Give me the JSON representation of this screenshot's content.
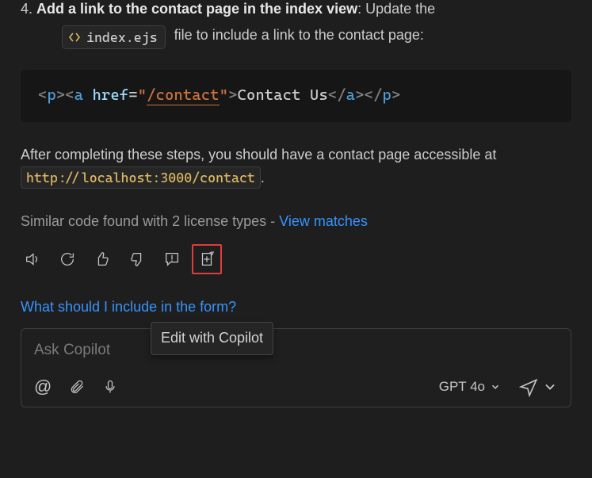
{
  "step": {
    "number": "4.",
    "bold": "Add a link to the contact page in the index view",
    "colon": ": Update the",
    "file_icon": "code-icon",
    "file_name": "index.ejs",
    "tail": "file to include a link to the contact page:"
  },
  "code": {
    "open_p_l": "<",
    "open_p_n": "p",
    "open_p_r": "><",
    "open_a_n": "a",
    "attr_name": " href",
    "attr_eq": "=",
    "attr_q1": "\"",
    "attr_val": "/contact",
    "attr_q2": "\"",
    "open_a_close": ">",
    "text": "Contact Us",
    "close_a": "</",
    "close_a_n": "a",
    "close_a_r": "></",
    "close_p_n": "p",
    "close_p_r": ">"
  },
  "para1_a": "After completing these steps, you should have a contact page accessible at ",
  "url_inline": "http://localhost:3000/contact",
  "para1_b": ".",
  "license_text": "Similar code found with 2 license types - ",
  "license_link": "View matches",
  "toolbar_names": {
    "speaker": "speaker-icon",
    "retry": "retry-icon",
    "thumbs_up": "thumbs-up-icon",
    "thumbs_down": "thumbs-down-icon",
    "comment": "comment-icon",
    "edit_copilot": "edit-with-copilot-icon"
  },
  "tooltip": "Edit with Copilot",
  "suggestion": "What should I include in the form?",
  "input": {
    "placeholder": "Ask Copilot",
    "at": "@",
    "model": "GPT 4o"
  }
}
